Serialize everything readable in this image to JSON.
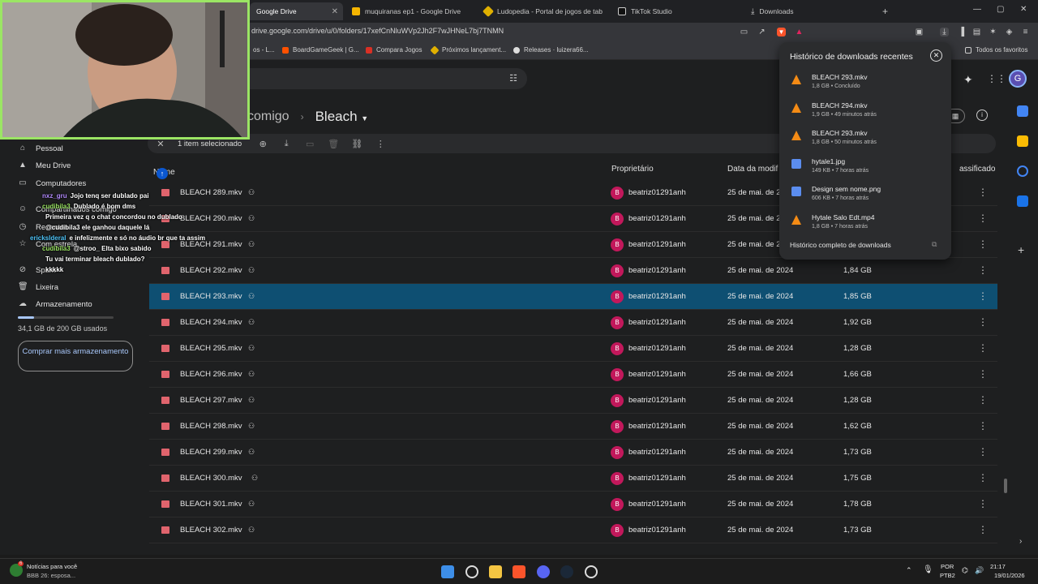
{
  "browser": {
    "tabs": [
      {
        "label": "Google Drive",
        "active": true
      },
      {
        "label": "muquiranas ep1 - Google Drive"
      },
      {
        "label": "Ludopedia - Portal de jogos de tabul..."
      },
      {
        "label": "TikTok Studio"
      },
      {
        "label": "Downloads"
      }
    ],
    "new_tab": "+",
    "url": "drive.google.com/drive/u/0/folders/17xefCnNluWVp2Jh2F7wJHNeL7bj7TNMN"
  },
  "bookmarks": [
    {
      "label": "os - L..."
    },
    {
      "label": "BoardGameGeek | G..."
    },
    {
      "label": "Compara Jogos"
    },
    {
      "label": "Próximos lançament..."
    },
    {
      "label": "Releases · luizera66..."
    }
  ],
  "bookmarks_all": "Todos os favoritos",
  "drive": {
    "breadcrumb_parent": "comigo",
    "breadcrumb_current": "Bleach",
    "selection_text": "1 item selecionado",
    "columns": {
      "name": "Nome",
      "owner": "Proprietário",
      "modified": "Data da modif",
      "size_partial": "assificado"
    },
    "files": [
      {
        "name": "BLEACH 289.mkv",
        "owner": "beatriz01291anh",
        "date": "25 de mai. de 2024",
        "size": ""
      },
      {
        "name": "BLEACH 290.mkv",
        "owner": "beatriz01291anh",
        "date": "25 de mai. de 2024",
        "size": ""
      },
      {
        "name": "BLEACH 291.mkv",
        "owner": "beatriz01291anh",
        "date": "25 de mai. de 2024",
        "size": ""
      },
      {
        "name": "BLEACH 292.mkv",
        "owner": "beatriz01291anh",
        "date": "25 de mai. de 2024",
        "size": "1,84 GB"
      },
      {
        "name": "BLEACH 293.mkv",
        "owner": "beatriz01291anh",
        "date": "25 de mai. de 2024",
        "size": "1,85 GB",
        "selected": true
      },
      {
        "name": "BLEACH 294.mkv",
        "owner": "beatriz01291anh",
        "date": "25 de mai. de 2024",
        "size": "1,92 GB"
      },
      {
        "name": "BLEACH 295.mkv",
        "owner": "beatriz01291anh",
        "date": "25 de mai. de 2024",
        "size": "1,28 GB"
      },
      {
        "name": "BLEACH 296.mkv",
        "owner": "beatriz01291anh",
        "date": "25 de mai. de 2024",
        "size": "1,66 GB"
      },
      {
        "name": "BLEACH 297.mkv",
        "owner": "beatriz01291anh",
        "date": "25 de mai. de 2024",
        "size": "1,28 GB"
      },
      {
        "name": "BLEACH 298.mkv",
        "owner": "beatriz01291anh",
        "date": "25 de mai. de 2024",
        "size": "1,62 GB"
      },
      {
        "name": "BLEACH 299.mkv",
        "owner": "beatriz01291anh",
        "date": "25 de mai. de 2024",
        "size": "1,73 GB"
      },
      {
        "name": "BLEACH 300.mkv",
        "owner": "beatriz01291anh",
        "date": "25 de mai. de 2024",
        "size": "1,75 GB"
      },
      {
        "name": "BLEACH 301.mkv",
        "owner": "beatriz01291anh",
        "date": "25 de mai. de 2024",
        "size": "1,78 GB"
      },
      {
        "name": "BLEACH 302.mkv",
        "owner": "beatriz01291anh",
        "date": "25 de mai. de 2024",
        "size": "1,73 GB"
      }
    ],
    "owner_initial": "B"
  },
  "sidebar": {
    "items": [
      {
        "label": "Pessoal"
      },
      {
        "label": "Meu Drive"
      },
      {
        "label": "Computadores"
      },
      {
        "label": "Compartilhados comigo"
      },
      {
        "label": "Recentes"
      },
      {
        "label": "Com estrela"
      },
      {
        "label": "Spam"
      },
      {
        "label": "Lixeira"
      },
      {
        "label": "Armazenamento"
      }
    ],
    "storage_text": "34,1 GB de 200 GB usados",
    "storage_used_fraction": 0.17,
    "buy_more": "Comprar mais armazenamento"
  },
  "chat": [
    {
      "user": "nxz_gru",
      "msg": "Jojo tenq ser dublado pai"
    },
    {
      "user": "cudibila3",
      "msg": "Dublado é bom dms"
    },
    {
      "user": "",
      "msg": "Primeira vez q o chat concordou no dublado"
    },
    {
      "user": "",
      "msg": "@cudibila3 ele ganhou daquele lá"
    },
    {
      "user": "erickslderal",
      "msg": "e infelizmente e só no áudio br que ta assim"
    },
    {
      "user": "cudibila3",
      "msg": "@stroo_ Elta bixo sabido"
    },
    {
      "user": "",
      "msg": "Tu vai terminar bleach dublado?"
    },
    {
      "user": "",
      "msg": "kkkkk"
    }
  ],
  "downloads": {
    "title": "Histórico de downloads recentes",
    "items": [
      {
        "name": "BLEACH 293.mkv",
        "status": "1,8 GB • Concluído",
        "type": "video"
      },
      {
        "name": "BLEACH 294.mkv",
        "status": "1,9 GB • 49 minutos atrás",
        "type": "video"
      },
      {
        "name": "BLEACH 293.mkv",
        "status": "1,8 GB • 50 minutos atrás",
        "type": "video"
      },
      {
        "name": "hytale1.jpg",
        "status": "149 KB • 7 horas atrás",
        "type": "doc"
      },
      {
        "name": "Design sem nome.png",
        "status": "606 KB • 7 horas atrás",
        "type": "doc"
      },
      {
        "name": "Hytale Salo Edt.mp4",
        "status": "1,8 GB • 7 horas atrás",
        "type": "video"
      }
    ],
    "full_history": "Histórico completo de downloads"
  },
  "taskbar": {
    "news_title": "Notícias para você",
    "news_sub": "BBB 26: esposa...",
    "news_badge": "6",
    "lang": "POR",
    "layout": "PTB2",
    "time": "21:17",
    "date": "19/01/2026"
  },
  "colors": {
    "accent": "#0b57d0",
    "selected_row": "#0e4f72",
    "file_icon": "#e0646d"
  }
}
